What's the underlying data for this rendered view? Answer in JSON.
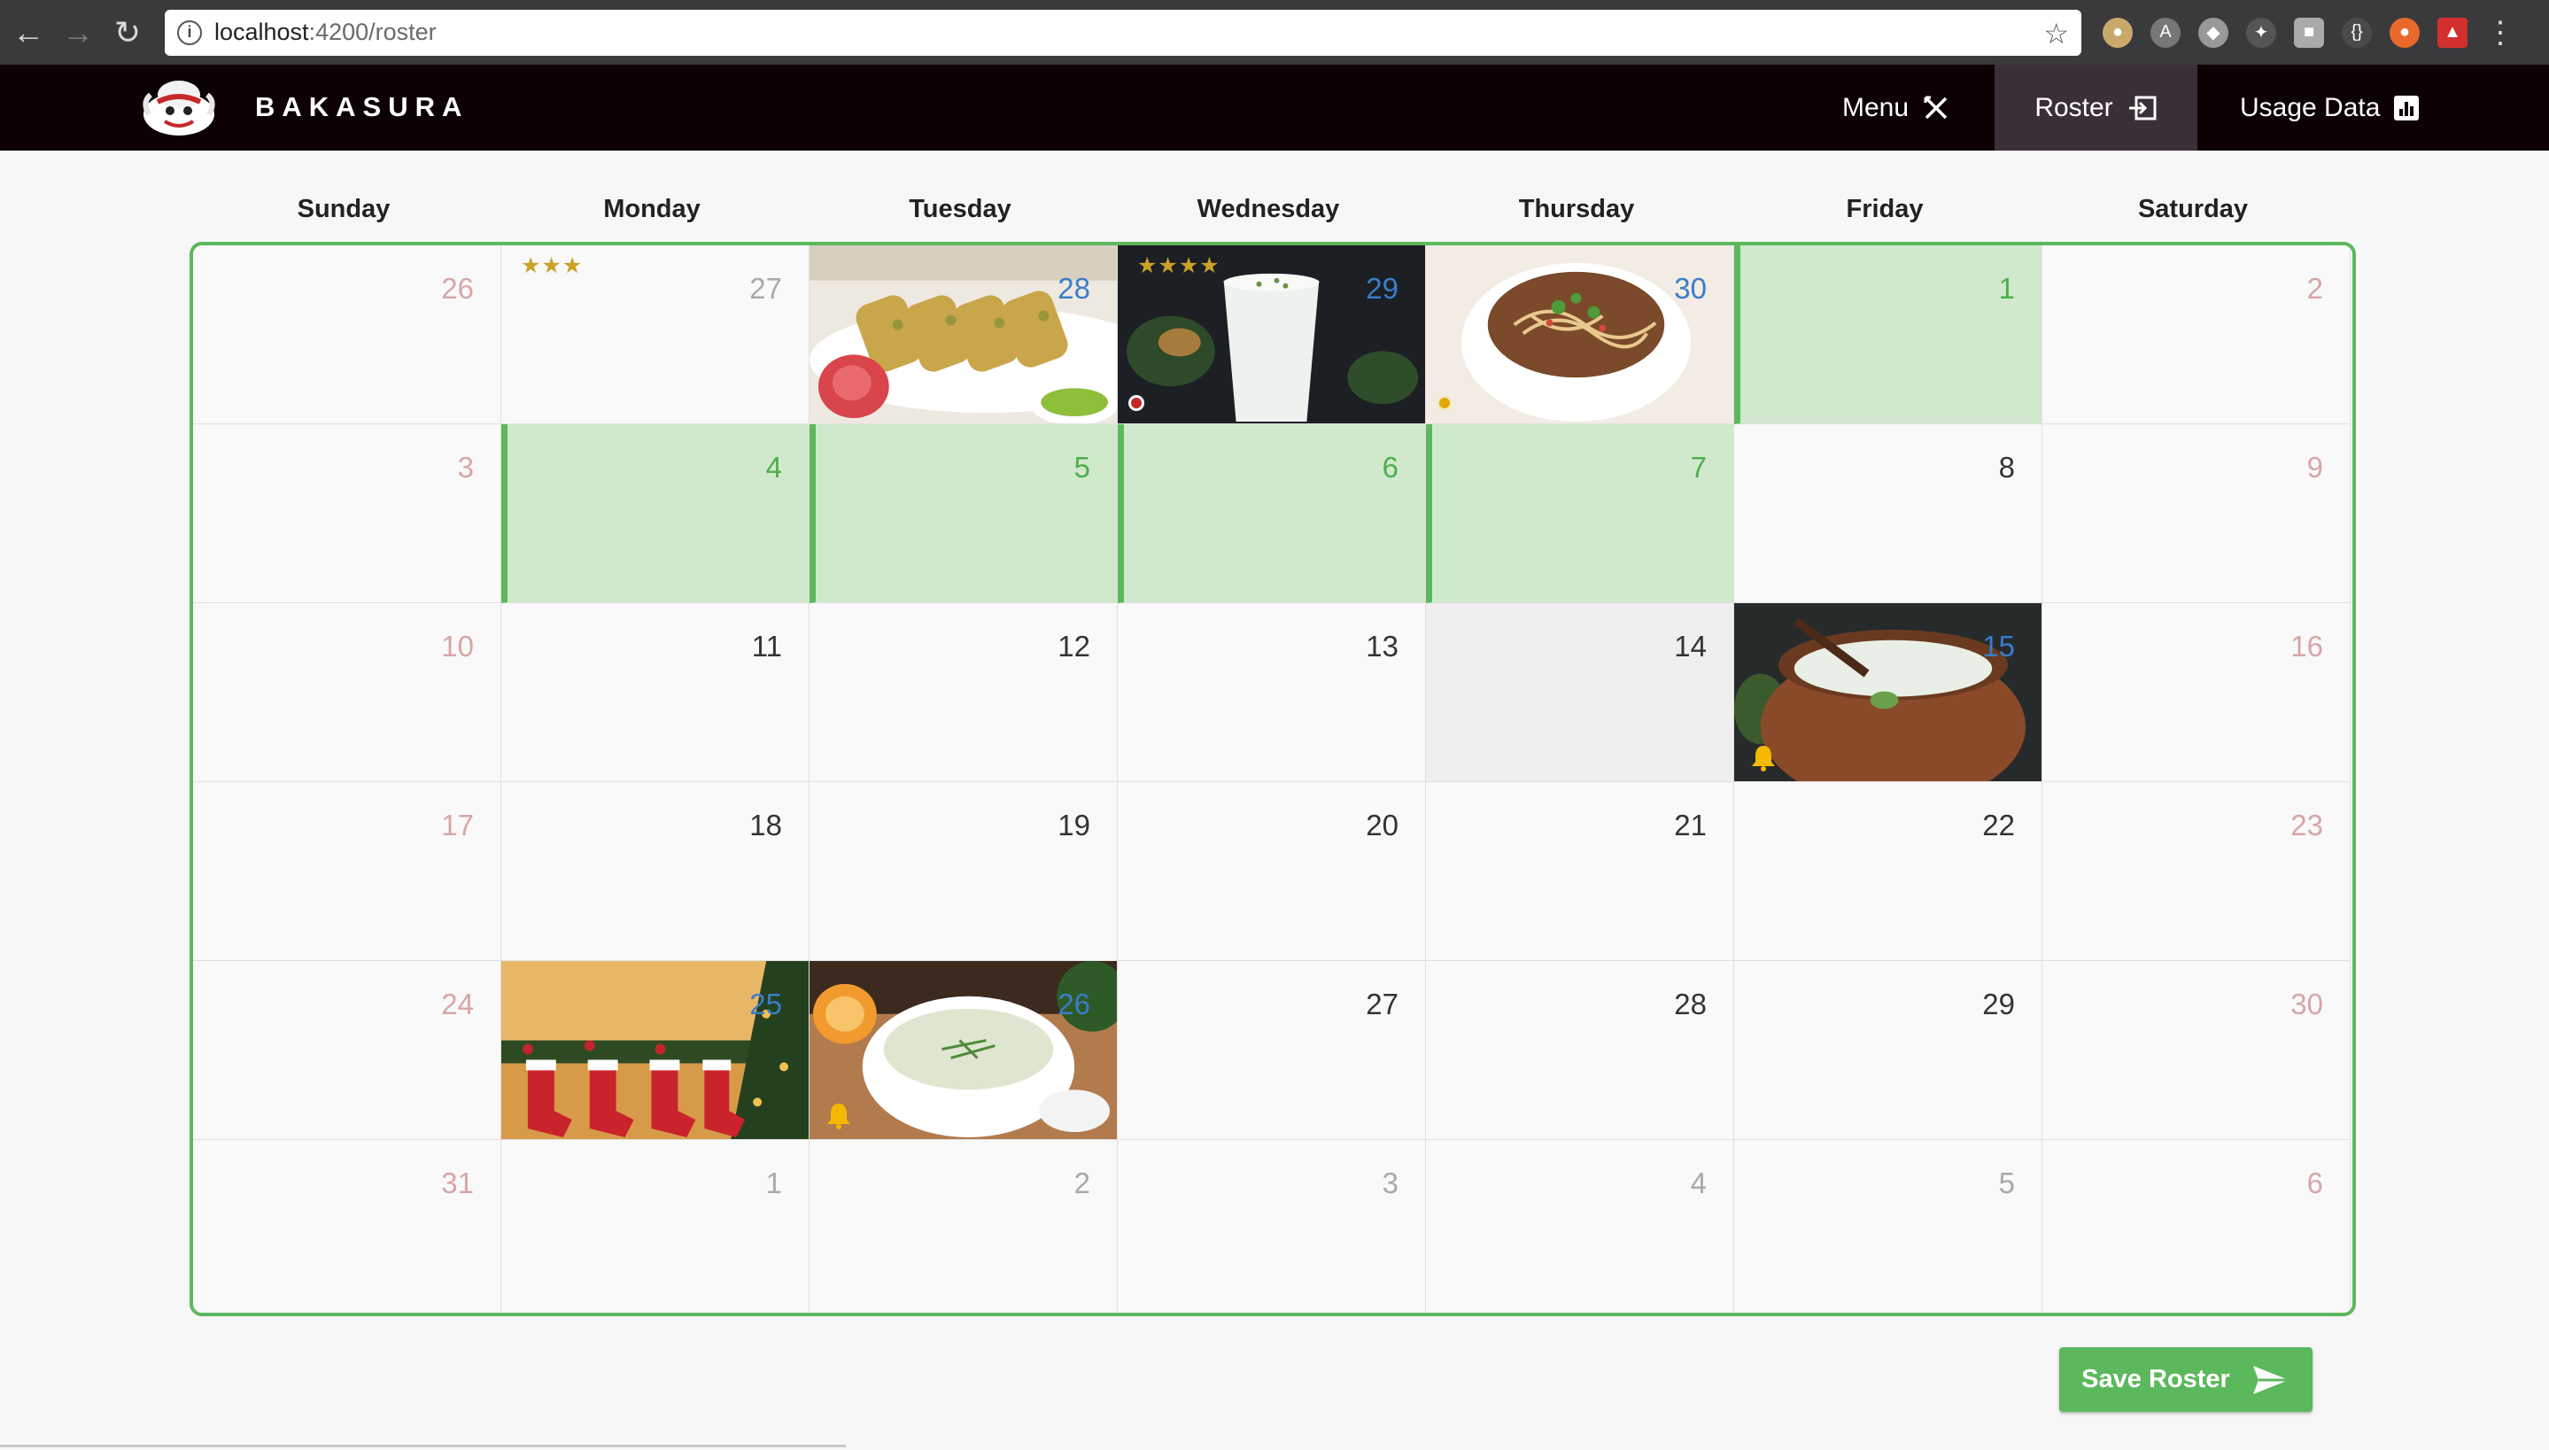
{
  "browser": {
    "url_host": "localhost",
    "url_path": ":4200/roster"
  },
  "header": {
    "brand": "BAKASURA",
    "nav": [
      {
        "label": "Menu"
      },
      {
        "label": "Roster"
      },
      {
        "label": "Usage Data"
      }
    ]
  },
  "calendar": {
    "weekdays": [
      "Sunday",
      "Monday",
      "Tuesday",
      "Wednesday",
      "Thursday",
      "Friday",
      "Saturday"
    ],
    "weeks": [
      [
        {
          "day": "26",
          "style": "dim-red"
        },
        {
          "day": "27",
          "style": "dim",
          "stars": "★★★"
        },
        {
          "day": "28",
          "style": "blue",
          "image": "kebab-platter"
        },
        {
          "day": "29",
          "style": "blue",
          "image": "buttermilk-glass",
          "stars": "★★★★",
          "dot": "red"
        },
        {
          "day": "30",
          "style": "blue",
          "image": "noodle-soup",
          "dot": "yellow"
        },
        {
          "day": "1",
          "style": "green",
          "highlight": "green"
        },
        {
          "day": "2",
          "style": "dim-red"
        }
      ],
      [
        {
          "day": "3",
          "style": "dim-red"
        },
        {
          "day": "4",
          "style": "green",
          "highlight": "green"
        },
        {
          "day": "5",
          "style": "green",
          "highlight": "green"
        },
        {
          "day": "6",
          "style": "green",
          "highlight": "green"
        },
        {
          "day": "7",
          "style": "green",
          "highlight": "green"
        },
        {
          "day": "8",
          "style": "normal"
        },
        {
          "day": "9",
          "style": "dim-red"
        }
      ],
      [
        {
          "day": "10",
          "style": "dim-red"
        },
        {
          "day": "11",
          "style": "normal"
        },
        {
          "day": "12",
          "style": "normal"
        },
        {
          "day": "13",
          "style": "normal"
        },
        {
          "day": "14",
          "style": "normal",
          "highlight": "grey"
        },
        {
          "day": "15",
          "style": "blue",
          "image": "clay-pot-buttermilk",
          "bell": true
        },
        {
          "day": "16",
          "style": "dim-red"
        }
      ],
      [
        {
          "day": "17",
          "style": "dim-red"
        },
        {
          "day": "18",
          "style": "normal"
        },
        {
          "day": "19",
          "style": "normal"
        },
        {
          "day": "20",
          "style": "normal"
        },
        {
          "day": "21",
          "style": "normal"
        },
        {
          "day": "22",
          "style": "normal"
        },
        {
          "day": "23",
          "style": "dim-red"
        }
      ],
      [
        {
          "day": "24",
          "style": "dim-red"
        },
        {
          "day": "25",
          "style": "blue",
          "image": "christmas-stockings"
        },
        {
          "day": "26",
          "style": "blue",
          "image": "yogurt-soup-bowl",
          "bell": true
        },
        {
          "day": "27",
          "style": "normal"
        },
        {
          "day": "28",
          "style": "normal"
        },
        {
          "day": "29",
          "style": "normal"
        },
        {
          "day": "30",
          "style": "dim-red"
        }
      ],
      [
        {
          "day": "31",
          "style": "dim-red"
        },
        {
          "day": "1",
          "style": "dim"
        },
        {
          "day": "2",
          "style": "dim"
        },
        {
          "day": "3",
          "style": "dim"
        },
        {
          "day": "4",
          "style": "dim"
        },
        {
          "day": "5",
          "style": "dim"
        },
        {
          "day": "6",
          "style": "dim-red"
        }
      ]
    ]
  },
  "actions": {
    "save_label": "Save Roster"
  },
  "colors": {
    "accent_green": "#5cb85c",
    "highlight_green": "#d0e9cd",
    "header_bg": "#0d0104",
    "star_gold": "#c9a227"
  }
}
